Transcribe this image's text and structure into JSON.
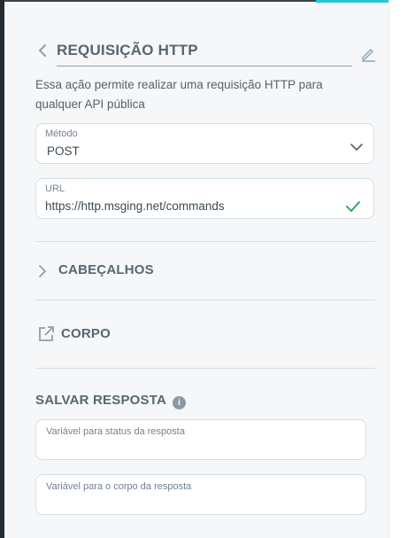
{
  "header": {
    "title": "REQUISIÇÃO HTTP"
  },
  "description": "Essa ação permite realizar uma requisição HTTP para qualquer API pública",
  "method_field": {
    "label": "Método",
    "value": "POST"
  },
  "url_field": {
    "label": "URL",
    "value": "https://http.msging.net/commands"
  },
  "sections": {
    "headers": "CABEÇALHOS",
    "body": "CORPO"
  },
  "save_response": {
    "title": "SALVAR RESPOSTA",
    "info_symbol": "i",
    "status_placeholder": "Variável para status da resposta",
    "body_placeholder": "Variável para o corpo da resposta"
  },
  "colors": {
    "accent": "#2cc3d5",
    "check": "#21a360",
    "text": "#566770",
    "border": "#d2dfe6"
  }
}
